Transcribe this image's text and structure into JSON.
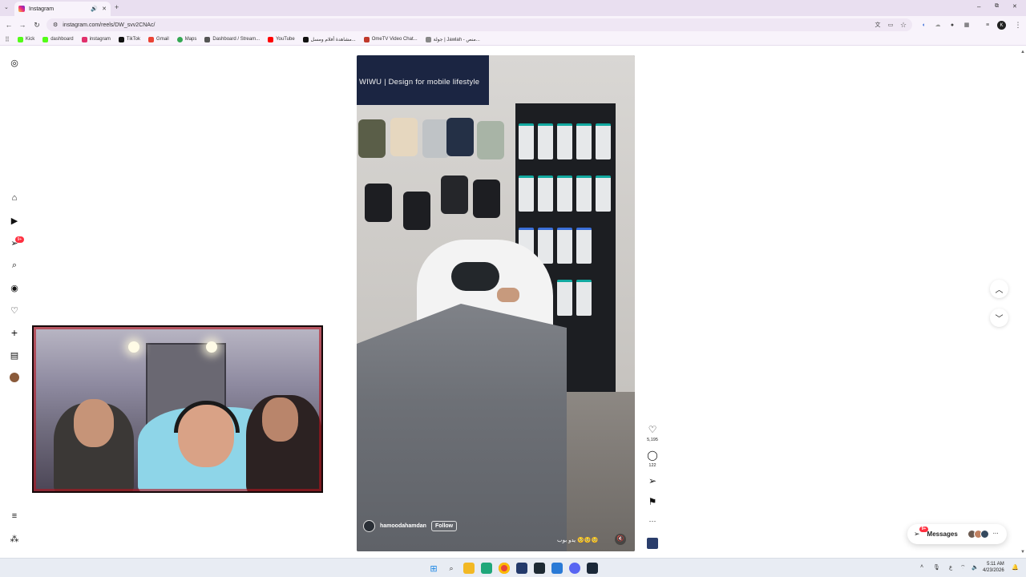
{
  "browser": {
    "tab_title": "Instagram",
    "tab_audio_icon": "speaker-icon",
    "new_tab": "+",
    "url": "instagram.com/reels/DW_svv2CNAc/",
    "window_min": "–",
    "window_max": "⧉",
    "window_close": "✕",
    "profile_initial": "K"
  },
  "bookmarks": [
    {
      "label": "Kick",
      "color": "#53fc18"
    },
    {
      "label": "dashboard",
      "color": "#53fc18"
    },
    {
      "label": "instagram",
      "color": "#e1306c"
    },
    {
      "label": "TikTok",
      "color": "#111111"
    },
    {
      "label": "Gmail",
      "color": "#ea4335"
    },
    {
      "label": "Maps",
      "color": "#34a853"
    },
    {
      "label": "Dashboard / Stream...",
      "color": "#555555"
    },
    {
      "label": "YouTube",
      "color": "#ff0000"
    },
    {
      "label": "مشاهدة أفلام ومسل...",
      "color": "#111111"
    },
    {
      "label": "OmeTV Video Chat...",
      "color": "#c0392b"
    },
    {
      "label": "جولة | Jawlah - منص...",
      "color": "#888888"
    }
  ],
  "sidebar": {
    "items": [
      {
        "name": "instagram-logo-icon",
        "glyph": "◎"
      },
      {
        "name": "home-icon",
        "glyph": "⌂"
      },
      {
        "name": "reels-icon",
        "glyph": "▶"
      },
      {
        "name": "direct-messages-icon",
        "glyph": "➢"
      },
      {
        "name": "search-icon",
        "glyph": "⌕"
      },
      {
        "name": "explore-icon",
        "glyph": "◉"
      },
      {
        "name": "notifications-heart-icon",
        "glyph": "♡"
      },
      {
        "name": "create-icon",
        "glyph": "+"
      },
      {
        "name": "insights-icon",
        "glyph": "▤"
      },
      {
        "name": "profile-avatar",
        "glyph": ""
      },
      {
        "name": "more-menu-icon",
        "glyph": "≡"
      },
      {
        "name": "meta-apps-icon",
        "glyph": "⁂"
      }
    ],
    "dm_badge": "9+"
  },
  "reel": {
    "sign_text": "WIWU | Design for mobile lifestyle",
    "author": "hamoodahamdan",
    "follow_label": "Follow",
    "caption": "يدو بوب 🥺🥺🥺",
    "audio_icon": "muted-icon"
  },
  "actions": {
    "like_count": "5,195",
    "comment_count": "122",
    "more": "···"
  },
  "messages": {
    "label": "Messages",
    "badge": "9+"
  },
  "clock": {
    "time": "5:11 AM",
    "date": "4/23/2026"
  },
  "taskbar": {
    "lang": "ع"
  }
}
